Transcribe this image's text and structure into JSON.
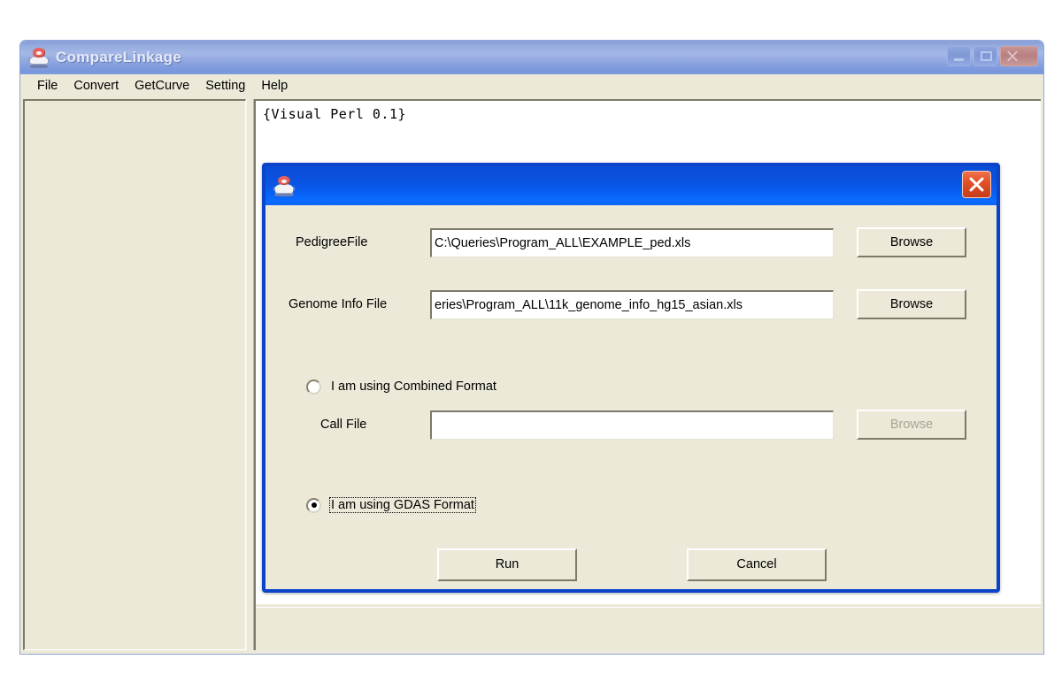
{
  "app": {
    "title": "CompareLinkage",
    "icon": "java-duke-icon",
    "window_buttons": [
      {
        "name": "minimize",
        "glyph": "minimize-icon"
      },
      {
        "name": "maximize",
        "glyph": "maximize-icon"
      },
      {
        "name": "close",
        "glyph": "close-icon"
      }
    ],
    "menu": [
      {
        "label": "File"
      },
      {
        "label": "Convert"
      },
      {
        "label": "GetCurve"
      },
      {
        "label": "Setting"
      },
      {
        "label": "Help"
      }
    ],
    "console": {
      "lines": [
        "{Visual Perl 0.1}"
      ]
    },
    "colors": {
      "titlebar_blue": "#8ba3da",
      "face": "#ece9d8",
      "console_bg": "#ffffff",
      "shadow": "#7d7a69"
    }
  },
  "dialog": {
    "title": "",
    "icon": "java-duke-icon",
    "close_label": "close-icon",
    "accent_border": "#0b44c8",
    "titlebar_blue": "#0a56e6",
    "fields": [
      {
        "label": "PedigreeFile",
        "value": "C:\\Queries\\Program_ALL\\EXAMPLE_ped.xls",
        "placeholder": "",
        "browse_label": "Browse",
        "browse_enabled": true
      },
      {
        "label": "Genome Info File",
        "value": "eries\\Program_ALL\\11k_genome_info_hg15_asian.xls",
        "placeholder": "",
        "browse_label": "Browse",
        "browse_enabled": true
      }
    ],
    "call_file": {
      "label": "Call File",
      "value": "",
      "placeholder": "",
      "browse_label": "Browse",
      "browse_enabled": false
    },
    "radios": [
      {
        "label": "I am using Combined Format",
        "checked": false,
        "focused": false
      },
      {
        "label": "I am using GDAS Format",
        "checked": true,
        "focused": true
      }
    ],
    "actions": {
      "run_label": "Run",
      "cancel_label": "Cancel"
    }
  }
}
